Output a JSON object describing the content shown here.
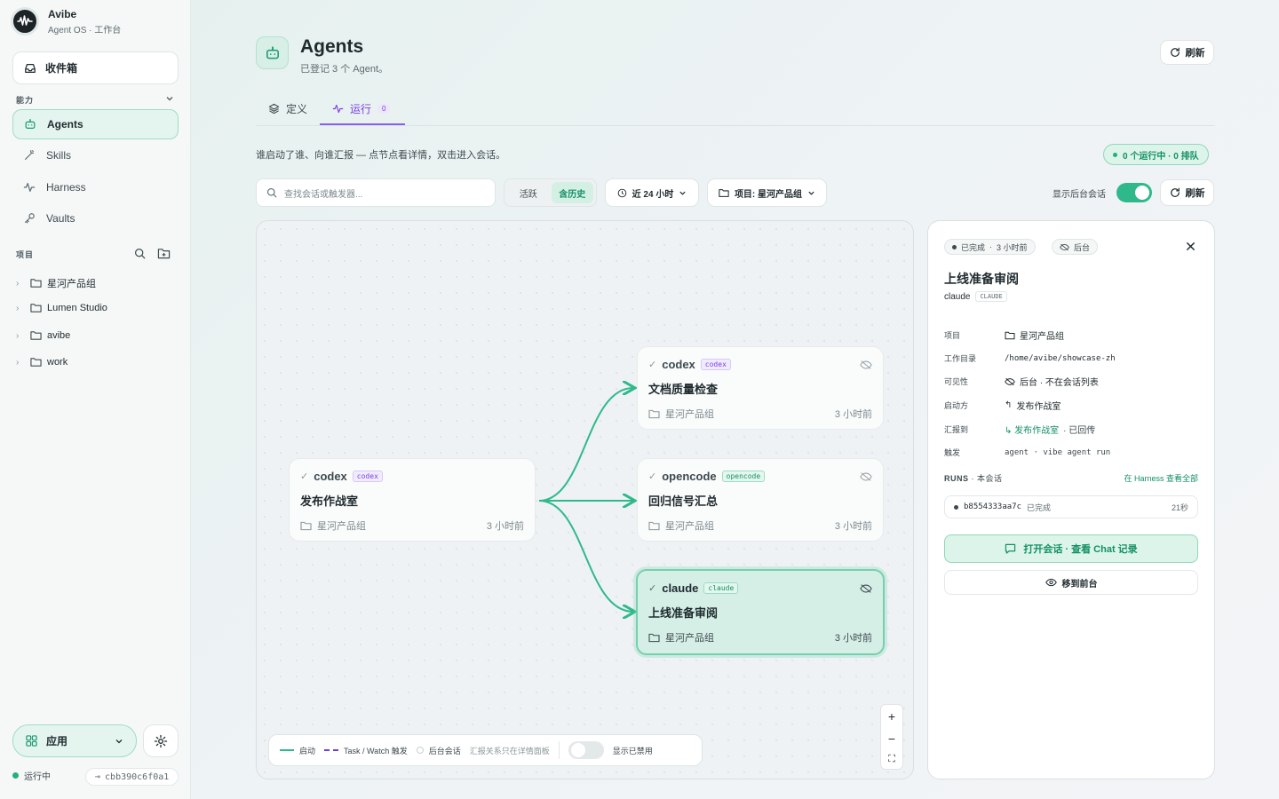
{
  "brand": {
    "name": "Avibe",
    "sub": "Agent OS · 工作台"
  },
  "sidebar": {
    "inbox": "收件箱",
    "section_capability": "能力",
    "items": [
      {
        "label": "Agents",
        "icon": "robot-icon"
      },
      {
        "label": "Skills",
        "icon": "wand-icon"
      },
      {
        "label": "Harness",
        "icon": "activity-icon"
      },
      {
        "label": "Vaults",
        "icon": "key-icon"
      }
    ],
    "section_projects": "项目",
    "projects": [
      "星河产品组",
      "Lumen Studio",
      "avibe",
      "work"
    ],
    "app_button": "应用",
    "status": "运行中",
    "hash": "cbb390c6f0a1"
  },
  "header": {
    "title": "Agents",
    "subtitle": "已登记 3 个 Agent。",
    "refresh": "刷新"
  },
  "tabs": [
    {
      "label": "定义"
    },
    {
      "label": "运行",
      "count": "0"
    }
  ],
  "description": "谁启动了谁、向谁汇报 — 点节点看详情，双击进入会话。",
  "run_status": "0 个运行中 · 0 排队",
  "toolbar": {
    "search_placeholder": "查找会话或触发器...",
    "seg_active": "活跃",
    "seg_history": "含历史",
    "time_filter": "近 24 小时",
    "project_filter": "项目: 星河产品组",
    "show_background": "显示后台会话",
    "show_background_on": true,
    "refresh": "刷新"
  },
  "graph": {
    "nodes": [
      {
        "agent": "codex",
        "tag": "codex",
        "name": "发布作战室",
        "project": "星河产品组",
        "time": "3 小时前"
      },
      {
        "agent": "codex",
        "tag": "codex",
        "name": "文档质量检查",
        "project": "星河产品组",
        "time": "3 小时前"
      },
      {
        "agent": "opencode",
        "tag": "opencode",
        "name": "回归信号汇总",
        "project": "星河产品组",
        "time": "3 小时前"
      },
      {
        "agent": "claude",
        "tag": "claude",
        "name": "上线准备审阅",
        "project": "星河产品组",
        "time": "3 小时前"
      }
    ],
    "edge_color": "#2fb98a"
  },
  "legend": {
    "start": "启动",
    "task": "Task / Watch 触发",
    "background": "后台会话",
    "note": "汇报关系只在详情面板",
    "show_disabled": "显示已禁用",
    "show_disabled_on": false
  },
  "panel": {
    "status": "已完成",
    "status_time": "3 小时前",
    "bg_badge": "后台",
    "title": "上线准备审阅",
    "agent": "claude",
    "agent_tag": "CLAUDE",
    "fields": [
      {
        "k": "项目",
        "v": "星河产品组"
      },
      {
        "k": "工作目录",
        "v": "/home/avibe/showcase-zh"
      },
      {
        "k": "可见性",
        "v": "后台 · 不在会话列表"
      },
      {
        "k": "启动方",
        "v": "发布作战室"
      },
      {
        "k": "汇报到",
        "v": "发布作战室",
        "extra": "· 已回传"
      },
      {
        "k": "触发",
        "v": "agent · vibe agent run"
      }
    ],
    "runs_label": "RUNS",
    "runs_scope": "本会话",
    "runs_link": "在 Harness 查看全部",
    "run": {
      "id": "b8554333aa7c",
      "status": "已完成",
      "duration": "21秒"
    },
    "open_chat": "打开会话 · 查看 Chat 记录",
    "move_front": "移到前台"
  },
  "colors": {
    "accent": "#2fb98a",
    "purple": "#7b3fe4"
  }
}
